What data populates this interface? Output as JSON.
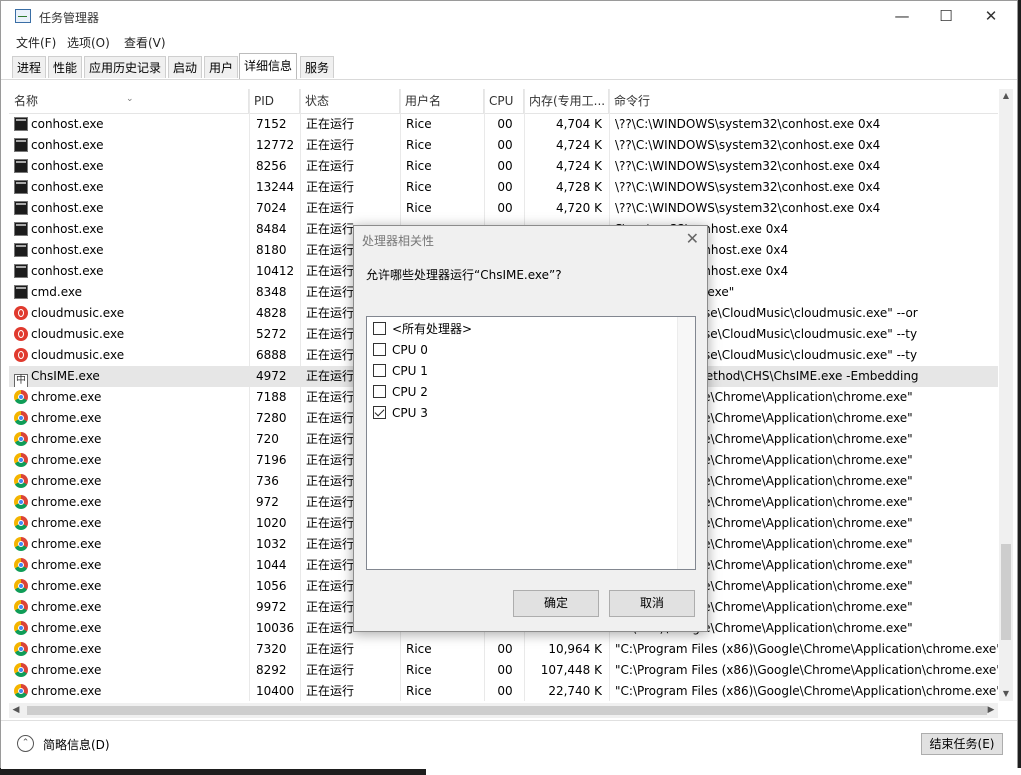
{
  "window": {
    "title": "任务管理器",
    "controls": {
      "minimize": "—",
      "maximize": "☐",
      "close": "✕"
    }
  },
  "menu": [
    "文件(F)",
    "选项(O)",
    "查看(V)"
  ],
  "tabs": [
    "进程",
    "性能",
    "应用历史记录",
    "启动",
    "用户",
    "详细信息",
    "服务"
  ],
  "active_tab": "详细信息",
  "table": {
    "columns": [
      "名称",
      "PID",
      "状态",
      "用户名",
      "CPU",
      "内存(专用工...",
      "命令行"
    ],
    "rows": [
      {
        "icon": "console-icon",
        "name": "conhost.exe",
        "pid": "7152",
        "status": "正在运行",
        "user": "Rice",
        "cpu": "00",
        "mem": "4,704 K",
        "cmd": "\\??\\C:\\WINDOWS\\system32\\conhost.exe 0x4"
      },
      {
        "icon": "console-icon",
        "name": "conhost.exe",
        "pid": "12772",
        "status": "正在运行",
        "user": "Rice",
        "cpu": "00",
        "mem": "4,724 K",
        "cmd": "\\??\\C:\\WINDOWS\\system32\\conhost.exe 0x4"
      },
      {
        "icon": "console-icon",
        "name": "conhost.exe",
        "pid": "8256",
        "status": "正在运行",
        "user": "Rice",
        "cpu": "00",
        "mem": "4,724 K",
        "cmd": "\\??\\C:\\WINDOWS\\system32\\conhost.exe 0x4"
      },
      {
        "icon": "console-icon",
        "name": "conhost.exe",
        "pid": "13244",
        "status": "正在运行",
        "user": "Rice",
        "cpu": "00",
        "mem": "4,728 K",
        "cmd": "\\??\\C:\\WINDOWS\\system32\\conhost.exe 0x4"
      },
      {
        "icon": "console-icon",
        "name": "conhost.exe",
        "pid": "7024",
        "status": "正在运行",
        "user": "Rice",
        "cpu": "00",
        "mem": "4,720 K",
        "cmd": "\\??\\C:\\WINDOWS\\system32\\conhost.exe 0x4"
      },
      {
        "icon": "console-icon",
        "name": "conhost.exe",
        "pid": "8484",
        "status": "正在运行",
        "user": "",
        "cpu": "",
        "mem": "",
        "cmd": "S\\system32\\conhost.exe 0x4"
      },
      {
        "icon": "console-icon",
        "name": "conhost.exe",
        "pid": "8180",
        "status": "正在运行",
        "user": "",
        "cpu": "",
        "mem": "",
        "cmd": "S\\system32\\conhost.exe 0x4"
      },
      {
        "icon": "console-icon",
        "name": "conhost.exe",
        "pid": "10412",
        "status": "正在运行",
        "user": "",
        "cpu": "",
        "mem": "",
        "cmd": "S\\system32\\conhost.exe 0x4"
      },
      {
        "icon": "console-icon",
        "name": "cmd.exe",
        "pid": "8348",
        "status": "正在运行",
        "user": "",
        "cpu": "",
        "mem": "",
        "cmd": "system32\\cmd.exe\""
      },
      {
        "icon": "netease-icon",
        "name": "cloudmusic.exe",
        "pid": "4828",
        "status": "正在运行",
        "user": "",
        "cpu": "",
        "mem": "",
        "cmd": "es (x86)\\Netease\\CloudMusic\\cloudmusic.exe\" --or"
      },
      {
        "icon": "netease-icon",
        "name": "cloudmusic.exe",
        "pid": "5272",
        "status": "正在运行",
        "user": "",
        "cpu": "",
        "mem": "",
        "cmd": "es (x86)\\Netease\\CloudMusic\\cloudmusic.exe\" --ty"
      },
      {
        "icon": "netease-icon",
        "name": "cloudmusic.exe",
        "pid": "6888",
        "status": "正在运行",
        "user": "",
        "cpu": "",
        "mem": "",
        "cmd": "es (x86)\\Netease\\CloudMusic\\cloudmusic.exe\" --ty"
      },
      {
        "icon": "ime-icon",
        "name": "ChsIME.exe",
        "pid": "4972",
        "status": "正在运行",
        "user": "",
        "cpu": "",
        "mem": "",
        "cmd": "stem32\\InputMethod\\CHS\\ChsIME.exe -Embedding",
        "selected": true
      },
      {
        "icon": "chrome-icon",
        "name": "chrome.exe",
        "pid": "7188",
        "status": "正在运行",
        "user": "",
        "cpu": "",
        "mem": "",
        "cmd": "es (x86)\\Google\\Chrome\\Application\\chrome.exe\""
      },
      {
        "icon": "chrome-icon",
        "name": "chrome.exe",
        "pid": "7280",
        "status": "正在运行",
        "user": "",
        "cpu": "",
        "mem": "",
        "cmd": "es (x86)\\Google\\Chrome\\Application\\chrome.exe\""
      },
      {
        "icon": "chrome-icon",
        "name": "chrome.exe",
        "pid": "720",
        "status": "正在运行",
        "user": "",
        "cpu": "",
        "mem": "",
        "cmd": "es (x86)\\Google\\Chrome\\Application\\chrome.exe\""
      },
      {
        "icon": "chrome-icon",
        "name": "chrome.exe",
        "pid": "7196",
        "status": "正在运行",
        "user": "",
        "cpu": "",
        "mem": "",
        "cmd": "es (x86)\\Google\\Chrome\\Application\\chrome.exe\""
      },
      {
        "icon": "chrome-icon",
        "name": "chrome.exe",
        "pid": "736",
        "status": "正在运行",
        "user": "",
        "cpu": "",
        "mem": "",
        "cmd": "es (x86)\\Google\\Chrome\\Application\\chrome.exe\""
      },
      {
        "icon": "chrome-icon",
        "name": "chrome.exe",
        "pid": "972",
        "status": "正在运行",
        "user": "",
        "cpu": "",
        "mem": "",
        "cmd": "es (x86)\\Google\\Chrome\\Application\\chrome.exe\""
      },
      {
        "icon": "chrome-icon",
        "name": "chrome.exe",
        "pid": "1020",
        "status": "正在运行",
        "user": "",
        "cpu": "",
        "mem": "",
        "cmd": "es (x86)\\Google\\Chrome\\Application\\chrome.exe\""
      },
      {
        "icon": "chrome-icon",
        "name": "chrome.exe",
        "pid": "1032",
        "status": "正在运行",
        "user": "",
        "cpu": "",
        "mem": "",
        "cmd": "es (x86)\\Google\\Chrome\\Application\\chrome.exe\""
      },
      {
        "icon": "chrome-icon",
        "name": "chrome.exe",
        "pid": "1044",
        "status": "正在运行",
        "user": "",
        "cpu": "",
        "mem": "",
        "cmd": "es (x86)\\Google\\Chrome\\Application\\chrome.exe\""
      },
      {
        "icon": "chrome-icon",
        "name": "chrome.exe",
        "pid": "1056",
        "status": "正在运行",
        "user": "",
        "cpu": "",
        "mem": "",
        "cmd": "es (x86)\\Google\\Chrome\\Application\\chrome.exe\""
      },
      {
        "icon": "chrome-icon",
        "name": "chrome.exe",
        "pid": "9972",
        "status": "正在运行",
        "user": "",
        "cpu": "",
        "mem": "",
        "cmd": "es (x86)\\Google\\Chrome\\Application\\chrome.exe\""
      },
      {
        "icon": "chrome-icon",
        "name": "chrome.exe",
        "pid": "10036",
        "status": "正在运行",
        "user": "",
        "cpu": "",
        "mem": "",
        "cmd": "es (x86)\\Google\\Chrome\\Application\\chrome.exe\""
      },
      {
        "icon": "chrome-icon",
        "name": "chrome.exe",
        "pid": "7320",
        "status": "正在运行",
        "user": "Rice",
        "cpu": "00",
        "mem": "10,964 K",
        "cmd": "\"C:\\Program Files (x86)\\Google\\Chrome\\Application\\chrome.exe\""
      },
      {
        "icon": "chrome-icon",
        "name": "chrome.exe",
        "pid": "8292",
        "status": "正在运行",
        "user": "Rice",
        "cpu": "00",
        "mem": "107,448 K",
        "cmd": "\"C:\\Program Files (x86)\\Google\\Chrome\\Application\\chrome.exe\""
      },
      {
        "icon": "chrome-icon",
        "name": "chrome.exe",
        "pid": "10400",
        "status": "正在运行",
        "user": "Rice",
        "cpu": "00",
        "mem": "22,740 K",
        "cmd": "\"C:\\Program Files (x86)\\Google\\Chrome\\Application\\chrome.exe\""
      }
    ]
  },
  "footer": {
    "brief_label": "简略信息(D)",
    "end_task_label": "结束任务(E)"
  },
  "dialog": {
    "title": "处理器相关性",
    "prompt": "允许哪些处理器运行“ChsIME.exe”?",
    "options": [
      {
        "label": "<所有处理器>",
        "checked": false
      },
      {
        "label": "CPU 0",
        "checked": false
      },
      {
        "label": "CPU 1",
        "checked": false
      },
      {
        "label": "CPU 2",
        "checked": false
      },
      {
        "label": "CPU 3",
        "checked": true
      }
    ],
    "ok_label": "确定",
    "cancel_label": "取消"
  }
}
